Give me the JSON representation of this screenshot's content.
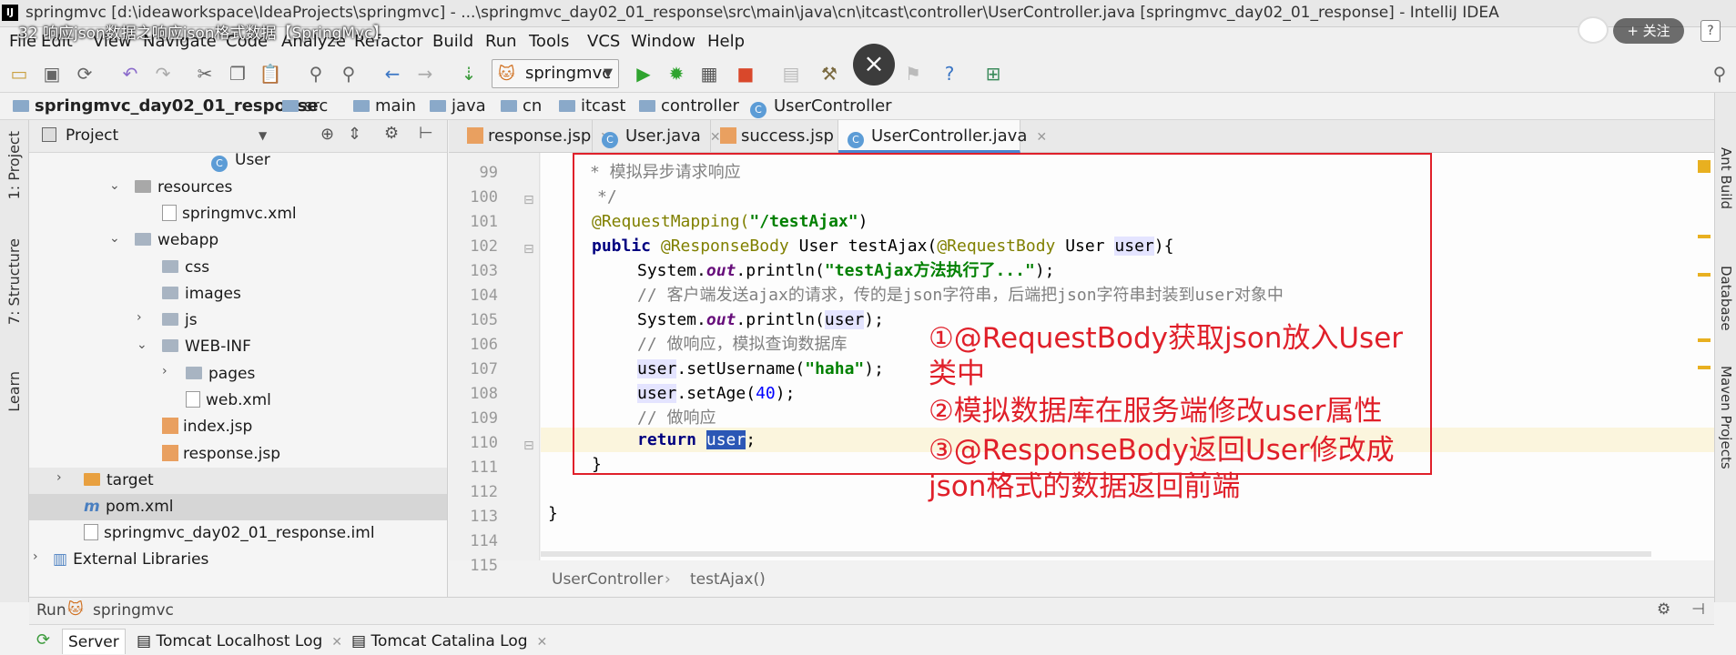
{
  "window": {
    "title": "springmvc [d:\\ideaworkspace\\IdeaProjects\\springmvc] - ...\\springmvc_day02_01_response\\src\\main\\java\\cn\\itcast\\controller\\UserController.java [springmvc_day02_01_response] - IntelliJ IDEA",
    "app_badge": "IJ"
  },
  "video_overlay": {
    "title": "32 响应json数据之响应json格式数据【SpringMvc】",
    "follow_label": "+ 关注",
    "help_label": "?",
    "close_label": "×"
  },
  "menu": [
    "File",
    "Edit",
    "View",
    "Navigate",
    "Code",
    "Analyze",
    "Refactor",
    "Build",
    "Run",
    "Tools",
    "VCS",
    "Window",
    "Help"
  ],
  "toolbar": {
    "run_config": "springmvc"
  },
  "breadcrumb": [
    "springmvc_day02_01_response",
    "src",
    "main",
    "java",
    "cn",
    "itcast",
    "controller",
    "UserController"
  ],
  "left_strip": [
    "1: Project",
    "7: Structure",
    "Learn"
  ],
  "project": {
    "header": "Project",
    "tree": [
      {
        "label": "User"
      },
      {
        "label": "resources"
      },
      {
        "label": "springmvc.xml"
      },
      {
        "label": "webapp"
      },
      {
        "label": "css"
      },
      {
        "label": "images"
      },
      {
        "label": "js"
      },
      {
        "label": "WEB-INF"
      },
      {
        "label": "pages"
      },
      {
        "label": "web.xml"
      },
      {
        "label": "index.jsp"
      },
      {
        "label": "response.jsp"
      },
      {
        "label": "target"
      },
      {
        "label": "pom.xml"
      },
      {
        "label": "springmvc_day02_01_response.iml"
      },
      {
        "label": "External Libraries"
      }
    ]
  },
  "editor": {
    "tabs": [
      "response.jsp",
      "User.java",
      "success.jsp",
      "UserController.java"
    ],
    "active_tab": "UserController.java",
    "line_numbers": [
      "99",
      "100",
      "101",
      "102",
      "103",
      "104",
      "105",
      "106",
      "107",
      "108",
      "109",
      "110",
      "111",
      "112",
      "113",
      "114",
      "115"
    ],
    "current_line": "110",
    "code_breadcrumb": [
      "UserController",
      "testAjax()"
    ],
    "lines": {
      "l99": "* 模拟异步请求响应",
      "l100": "*/",
      "l101_ann": "@RequestMapping(",
      "l101_str": "\"/testAjax\"",
      "l101_end": ")",
      "l102_kw": "public",
      "l102_ann1": "@ResponseBody",
      "l102_mid": " User testAjax(",
      "l102_ann2": "@RequestBody",
      "l102_type": " User ",
      "l102_param": "user",
      "l102_end": "){",
      "l103_a": "System.",
      "l103_out": "out",
      "l103_b": ".println(",
      "l103_str": "\"testAjax方法执行了...\"",
      "l103_end": ");",
      "l104": "// 客户端发送ajax的请求，传的是json字符串，后端把json字符串封装到user对象中",
      "l105_a": "System.",
      "l105_out": "out",
      "l105_b": ".println(",
      "l105_param": "user",
      "l105_end": ");",
      "l106": "// 做响应，模拟查询数据库",
      "l107_user": "user",
      "l107_b": ".setUsername(",
      "l107_str": "\"haha\"",
      "l107_end": ");",
      "l108_user": "user",
      "l108_b": ".setAge(",
      "l108_num": "40",
      "l108_end": ");",
      "l109": "// 做响应",
      "l110_kw": "return",
      "l110_sel": "user",
      "l110_end": ";",
      "l111": "}",
      "l113": "}"
    }
  },
  "annotations": [
    "①@RequestBody获取json放入User",
    "类中",
    "②模拟数据库在服务端修改user属性",
    "③@ResponseBody返回User修改成",
    "json格式的数据返回前端"
  ],
  "right_strip": [
    "Ant Build",
    "Database",
    "Maven Projects"
  ],
  "run_panel": {
    "title": "Run",
    "config": "springmvc",
    "tabs": [
      "Server",
      "Tomcat Localhost Log",
      "Tomcat Catalina Log"
    ]
  },
  "colors": {
    "annotation_red": "#e0202a",
    "active_tab_accent": "#4a86d1"
  }
}
